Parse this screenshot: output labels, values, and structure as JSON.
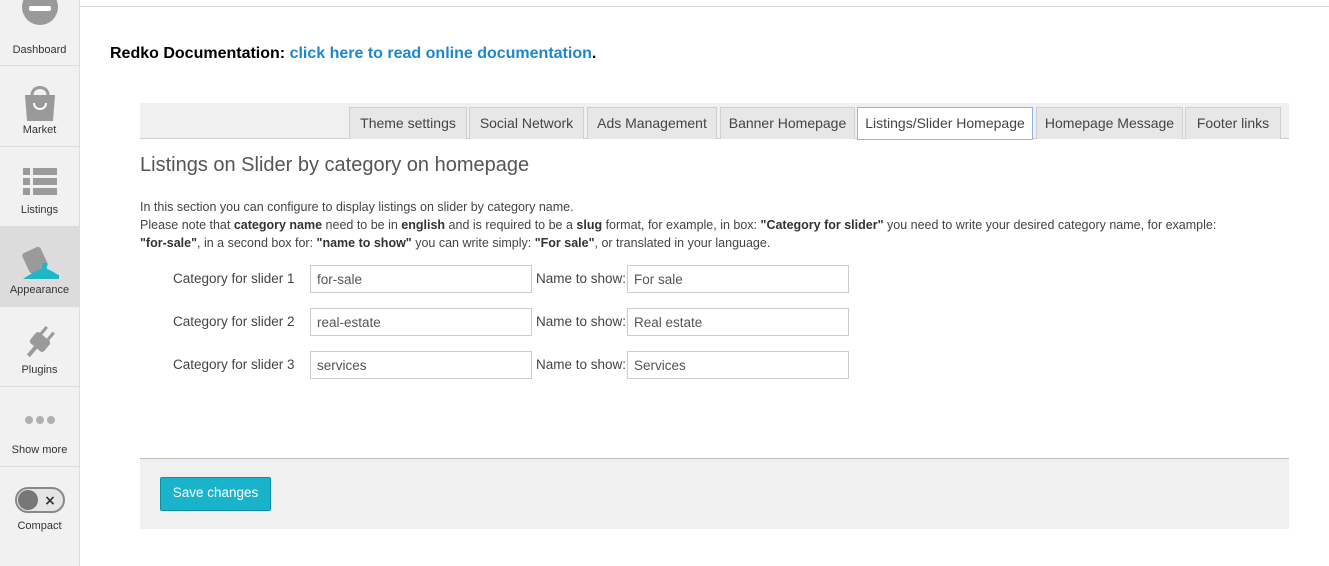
{
  "sidebar": {
    "items": [
      {
        "label": "Dashboard",
        "icon": "dashboard-icon"
      },
      {
        "label": "Market",
        "icon": "market-bag-icon"
      },
      {
        "label": "Listings",
        "icon": "list-icon"
      },
      {
        "label": "Appearance",
        "icon": "paint-bucket-icon"
      },
      {
        "label": "Plugins",
        "icon": "plug-icon"
      },
      {
        "label": "Show more",
        "icon": "more-dots-icon"
      },
      {
        "label": "Compact",
        "icon": "toggle-icon"
      }
    ],
    "active": "Appearance"
  },
  "doc": {
    "prefix": "Redko Documentation:",
    "link_text": "click here to read online documentation",
    "suffix": "."
  },
  "tabs": [
    {
      "label": "Theme settings"
    },
    {
      "label": "Social Network"
    },
    {
      "label": "Ads Management"
    },
    {
      "label": "Banner Homepage"
    },
    {
      "label": "Listings/Slider Homepage"
    },
    {
      "label": "Homepage Message"
    },
    {
      "label": "Footer links"
    }
  ],
  "active_tab": "Listings/Slider Homepage",
  "section": {
    "title": "Listings on Slider by category on homepage",
    "line1": "In this section you can configure to display listings on slider by category name.",
    "line2": {
      "t1": "Please note that ",
      "b1": "category name",
      "t2": " need to be in ",
      "b2": "english",
      "t3": " and is required to be a ",
      "b3": "slug",
      "t4": " format, for example, in box: ",
      "b4": "\"Category for slider\"",
      "t5": " you need to write your desired category name, for example:",
      "b5": "\"for-sale\"",
      "t6": ", in a second box for: ",
      "b6": "\"name to show\"",
      "t7": " you can write simply: ",
      "b7": "\"For sale\"",
      "t8": ", or translated in your language."
    }
  },
  "form": {
    "name_label": "Name to show:",
    "rows": [
      {
        "label": "Category for slider 1",
        "category": "for-sale",
        "name": "For sale"
      },
      {
        "label": "Category for slider 2",
        "category": "real-estate",
        "name": "Real estate"
      },
      {
        "label": "Category for slider 3",
        "category": "services",
        "name": "Services"
      }
    ]
  },
  "save_label": "Save changes",
  "colors": {
    "link": "#1e87cb",
    "button": "#19b4cc",
    "active_tab_border": "#8bb7e0",
    "appearance_accent": "#1fb6c8"
  }
}
